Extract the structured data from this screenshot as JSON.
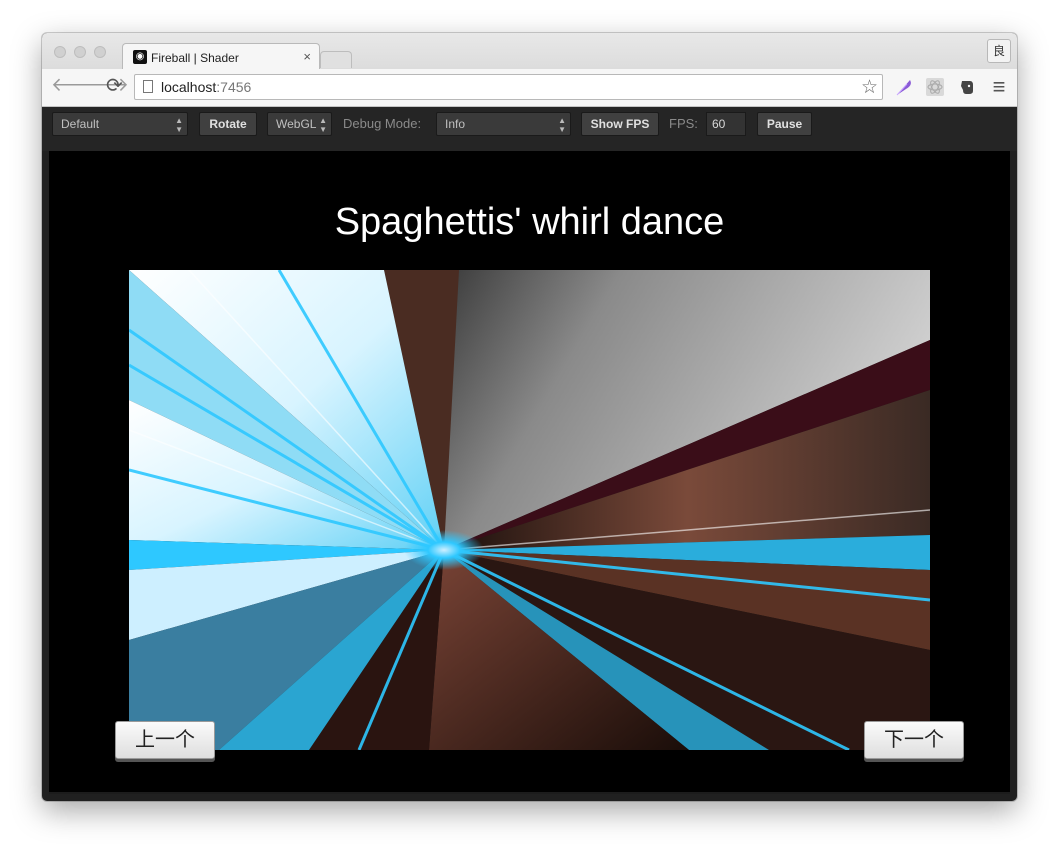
{
  "browser": {
    "tab_title": "Fireball | Shader",
    "tab_close": "×",
    "profile_glyph": "良",
    "url_host": "localhost",
    "url_port": ":7456",
    "back_icon": "🡐",
    "forward_icon": "🡒",
    "reload_icon": "⟳",
    "star_icon": "☆",
    "menu_icon": "≡"
  },
  "app_toolbar": {
    "device_select": "Default",
    "rotate_label": "Rotate",
    "renderer_select": "WebGL",
    "debug_mode_label": "Debug Mode:",
    "debug_mode_select": "Info",
    "show_fps_label": "Show FPS",
    "fps_label": "FPS:",
    "fps_value": "60",
    "pause_label": "Pause"
  },
  "scene": {
    "title": "Spaghettis' whirl dance",
    "prev_label": "上一个",
    "next_label": "下一个"
  },
  "colors": {
    "accent_cyan": "#2ec8ff",
    "brown": "#6b3a2a",
    "background": "#000000"
  }
}
